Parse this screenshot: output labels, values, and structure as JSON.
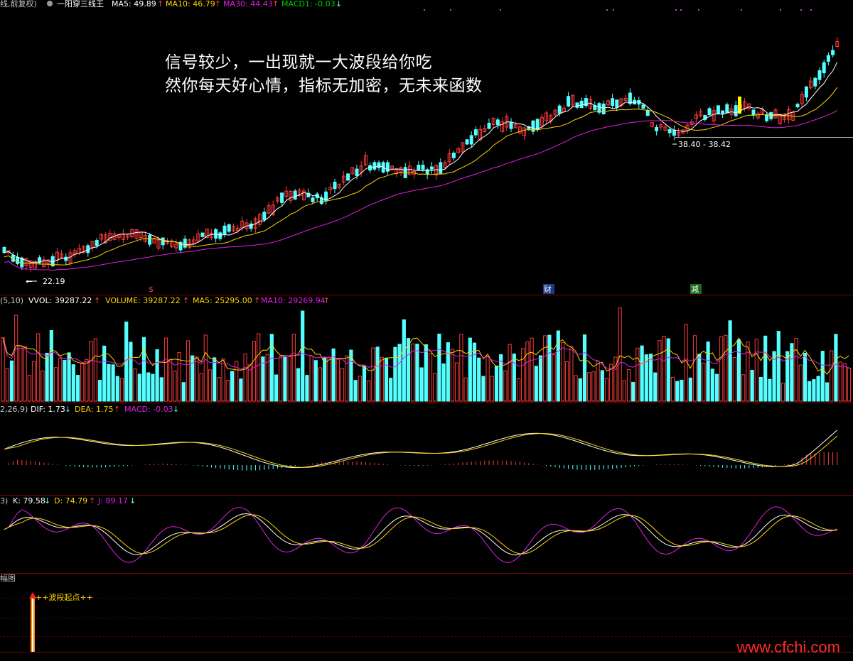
{
  "colors": {
    "background": "#000000",
    "up_candle": "#ff3b3b",
    "down_candle": "#54ffff",
    "ma5": "#ffffff",
    "ma10": "#ffd400",
    "ma30": "#e020e0",
    "grid": "#7a0000",
    "separator": "#8a0000"
  },
  "main_panel": {
    "header": {
      "title": "线,前复权)",
      "ma5": "MA5: 49.89",
      "ma10": "MA10: 46.79",
      "ma30": "MA30: 44.43",
      "macd": "MACD1: -0.03",
      "indicator_name": "一阳穿三线王"
    },
    "low_label": "22.19",
    "range_label": "38.40 - 38.42",
    "markers": [
      "$",
      "财",
      "减"
    ]
  },
  "overlay_text": {
    "line1": "信号较少，一出现就一大波段给你吃",
    "line2": "然你每天好心情，指标无加密，无未来函数"
  },
  "volume_panel": {
    "prefix": "(5,10)",
    "vvol": "VVOL: 39287.22",
    "volume": "VOLUME: 39287.22",
    "ma5": "MA5: 25295.00",
    "ma10": "MA10: 29269.94"
  },
  "macd_panel": {
    "prefix": "2,26,9)",
    "dif": "DIF: 1.73",
    "dea": "DEA: 1.75",
    "macd": "MACD: -0.03"
  },
  "kdj_panel": {
    "prefix": "3)",
    "k": "K: 79.58",
    "d": "D: 74.79",
    "j": "J: 89.17"
  },
  "signal_panel": {
    "title": "幅图",
    "signal_label": "++波段起点++"
  },
  "watermark": "www.cfchi.com"
}
